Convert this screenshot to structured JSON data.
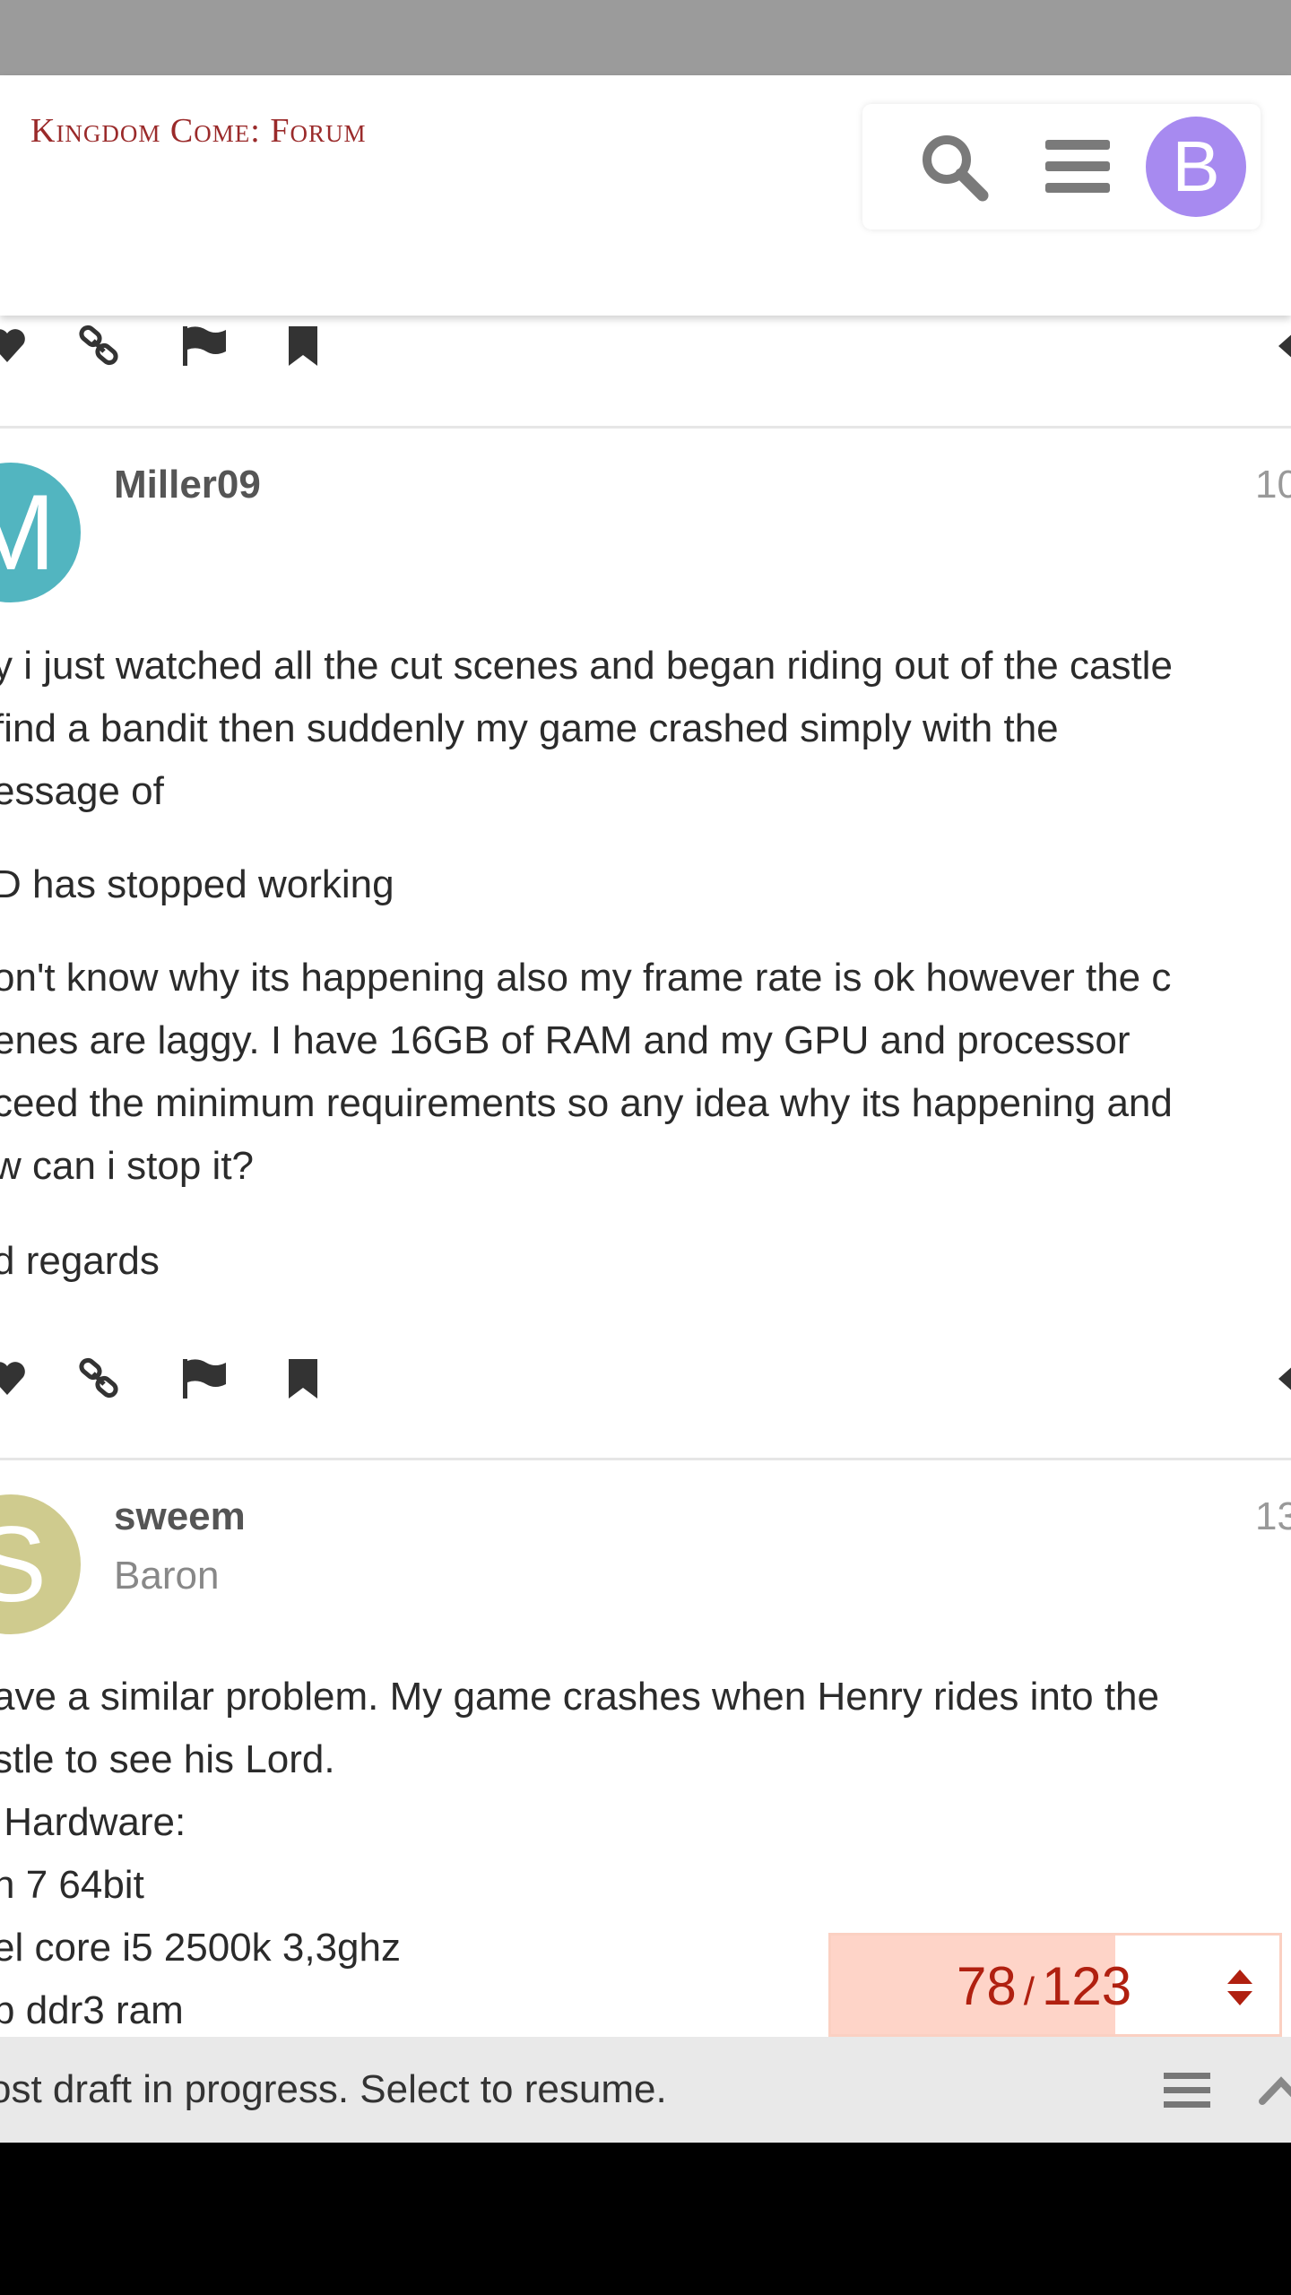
{
  "header": {
    "logo_text": "Kingdom Come: Forum",
    "avatar_letter": "B",
    "colors": {
      "logo": "#9a2a2a",
      "avatar": "#a78af0"
    }
  },
  "posts": [
    {
      "username": "Miller09",
      "avatar_letter": "M",
      "avatar_color": "#52b5c0",
      "date": "10",
      "paragraphs": [
        [
          "y i just watched all the cut scenes and began riding out of the castle",
          "find a bandit then suddenly my game crashed simply with the",
          "essage of"
        ],
        [
          "D has stopped working"
        ],
        [
          "on't know why its happening also my frame rate is ok however the c",
          "enes are laggy. I have 16GB of RAM and my GPU and processor",
          "ceed the minimum requirements so any idea why its happening and",
          "w can i stop it?"
        ],
        [
          "d regards"
        ]
      ]
    },
    {
      "username": "sweem",
      "title": "Baron",
      "avatar_letter": "S",
      "avatar_color": "#cfcb8e",
      "date": "13",
      "paragraphs": [
        [
          "ave a similar problem. My game crashes when Henry rides into the",
          "stle to see his Lord.",
          " Hardware:",
          "n 7 64bit",
          "el core i5 2500k 3,3ghz",
          "b ddr3 ram"
        ]
      ]
    }
  ],
  "progress": {
    "current": "78",
    "separator": "/",
    "total": "123",
    "fraction": 0.634
  },
  "draft": {
    "text": "ost draft in progress. Select to resume."
  },
  "icons": [
    "heart-icon",
    "link-icon",
    "flag-icon",
    "bookmark-icon",
    "search-icon",
    "hamburger-menu-icon",
    "chevron-up-icon",
    "list-icon"
  ]
}
